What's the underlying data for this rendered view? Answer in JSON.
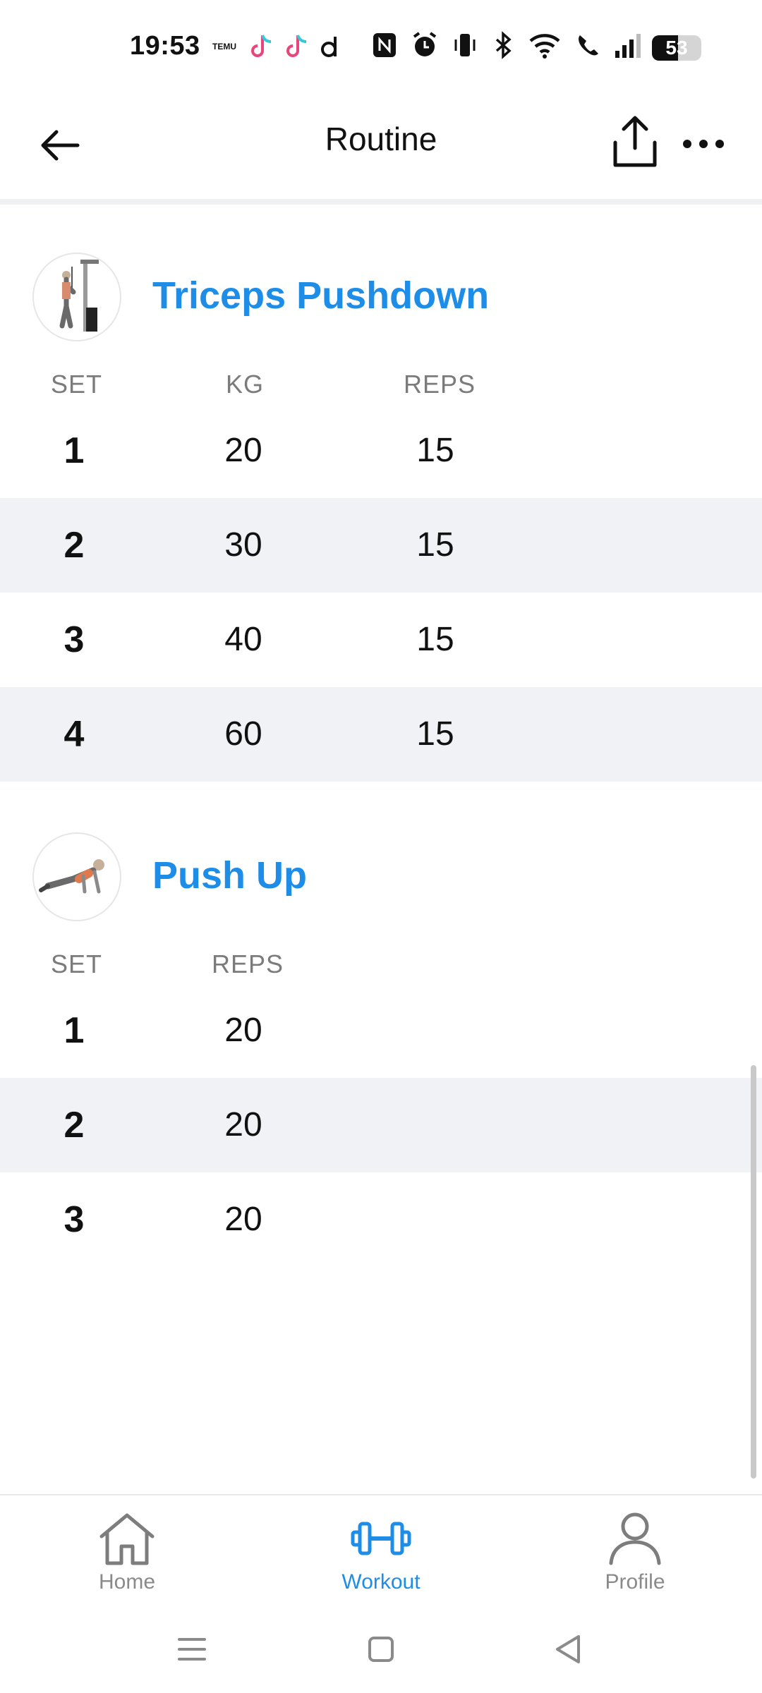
{
  "status_bar": {
    "time": "19:53",
    "temu_label": "TEMU",
    "battery_level": "53",
    "battery_fraction": 0.53
  },
  "header": {
    "title": "Routine"
  },
  "exercises": [
    {
      "name": "Triceps Pushdown",
      "columns": [
        "SET",
        "KG",
        "REPS"
      ],
      "rows": [
        {
          "set": "1",
          "kg": "20",
          "reps": "15"
        },
        {
          "set": "2",
          "kg": "30",
          "reps": "15"
        },
        {
          "set": "3",
          "kg": "40",
          "reps": "15"
        },
        {
          "set": "4",
          "kg": "60",
          "reps": "15"
        }
      ]
    },
    {
      "name": "Push Up",
      "columns": [
        "SET",
        "REPS"
      ],
      "rows": [
        {
          "set": "1",
          "reps": "20"
        },
        {
          "set": "2",
          "reps": "20"
        },
        {
          "set": "3",
          "reps": "20"
        }
      ]
    }
  ],
  "bottom_nav": {
    "items": [
      {
        "label": "Home",
        "icon": "home-icon"
      },
      {
        "label": "Workout",
        "icon": "dumbbell-icon"
      },
      {
        "label": "Profile",
        "icon": "person-icon"
      }
    ],
    "active": "Workout"
  },
  "colors": {
    "accent": "#1e8de8",
    "row_alt": "#f1f2f5",
    "text": "#111111",
    "muted": "#7b7b7b"
  }
}
